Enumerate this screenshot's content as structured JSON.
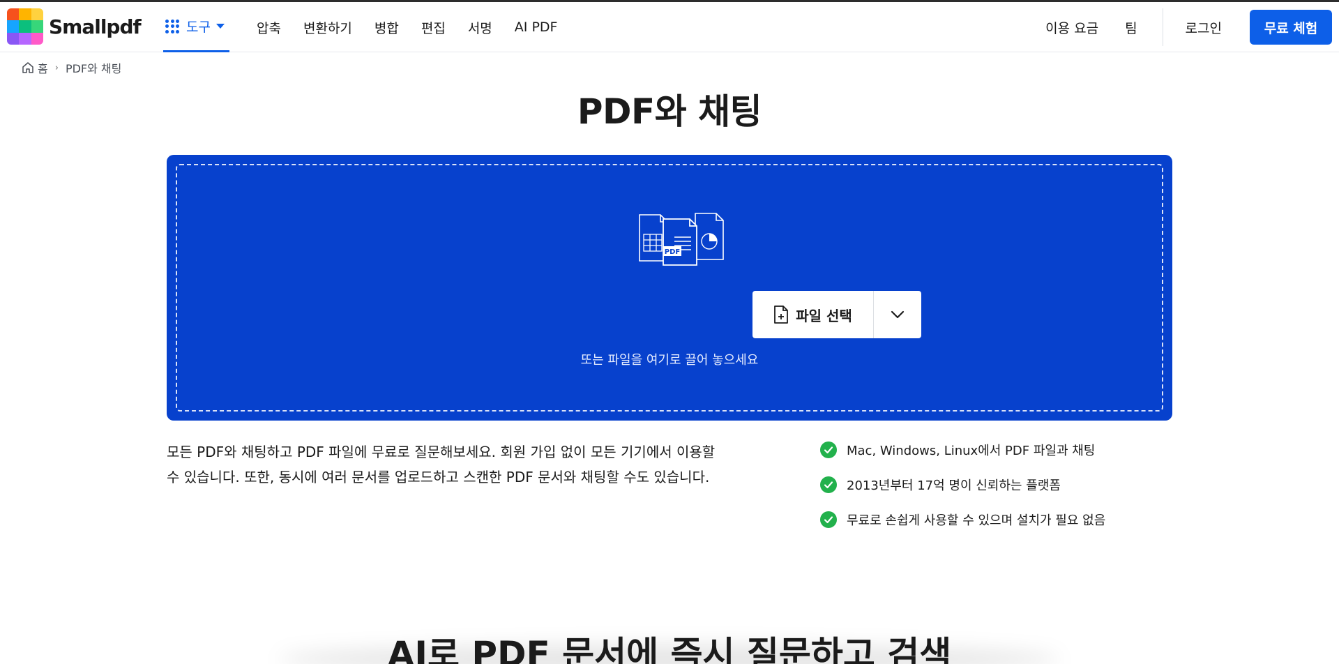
{
  "brand": {
    "name": "Smallpdf",
    "logo_colors": [
      "#f6511d",
      "#ffb400",
      "#ffd23f",
      "#16a5ff",
      "#0bbf7d",
      "#37d67a",
      "#8a57f5",
      "#b666ff",
      "#ff5ac8"
    ]
  },
  "nav": {
    "tools_label": "도구",
    "links": [
      "압축",
      "변환하기",
      "병합",
      "편집",
      "서명",
      "AI PDF"
    ],
    "right": {
      "pricing": "이용 요금",
      "team": "팀",
      "login": "로그인",
      "cta": "무료 체험"
    }
  },
  "breadcrumb": {
    "home": "홈",
    "current": "PDF와 채팅"
  },
  "page": {
    "title": "PDF와 채팅"
  },
  "dropzone": {
    "select_label": "파일 선택",
    "hint": "또는 파일을 여기로 끌어 놓으세요",
    "illustration_badge": "PDF"
  },
  "description": "모든 PDF와 채팅하고 PDF 파일에 무료로 질문해보세요. 회원 가입 없이 모든 기기에서 이용할 수 있습니다. 또한, 동시에 여러 문서를 업로드하고 스캔한 PDF 문서와 채팅할 수도 있습니다.",
  "features": [
    "Mac, Windows, Linux에서 PDF 파일과 채팅",
    "2013년부터 17억 명이 신뢰하는 플랫폼",
    "무료로 손쉽게 사용할 수 있으며 설치가 필요 없음"
  ],
  "section": {
    "title": "AI로 PDF 문서에 즉시 질문하고 검색"
  },
  "colors": {
    "accent": "#0d5fe8",
    "dropzone": "#0741cd",
    "check": "#22b14c"
  }
}
